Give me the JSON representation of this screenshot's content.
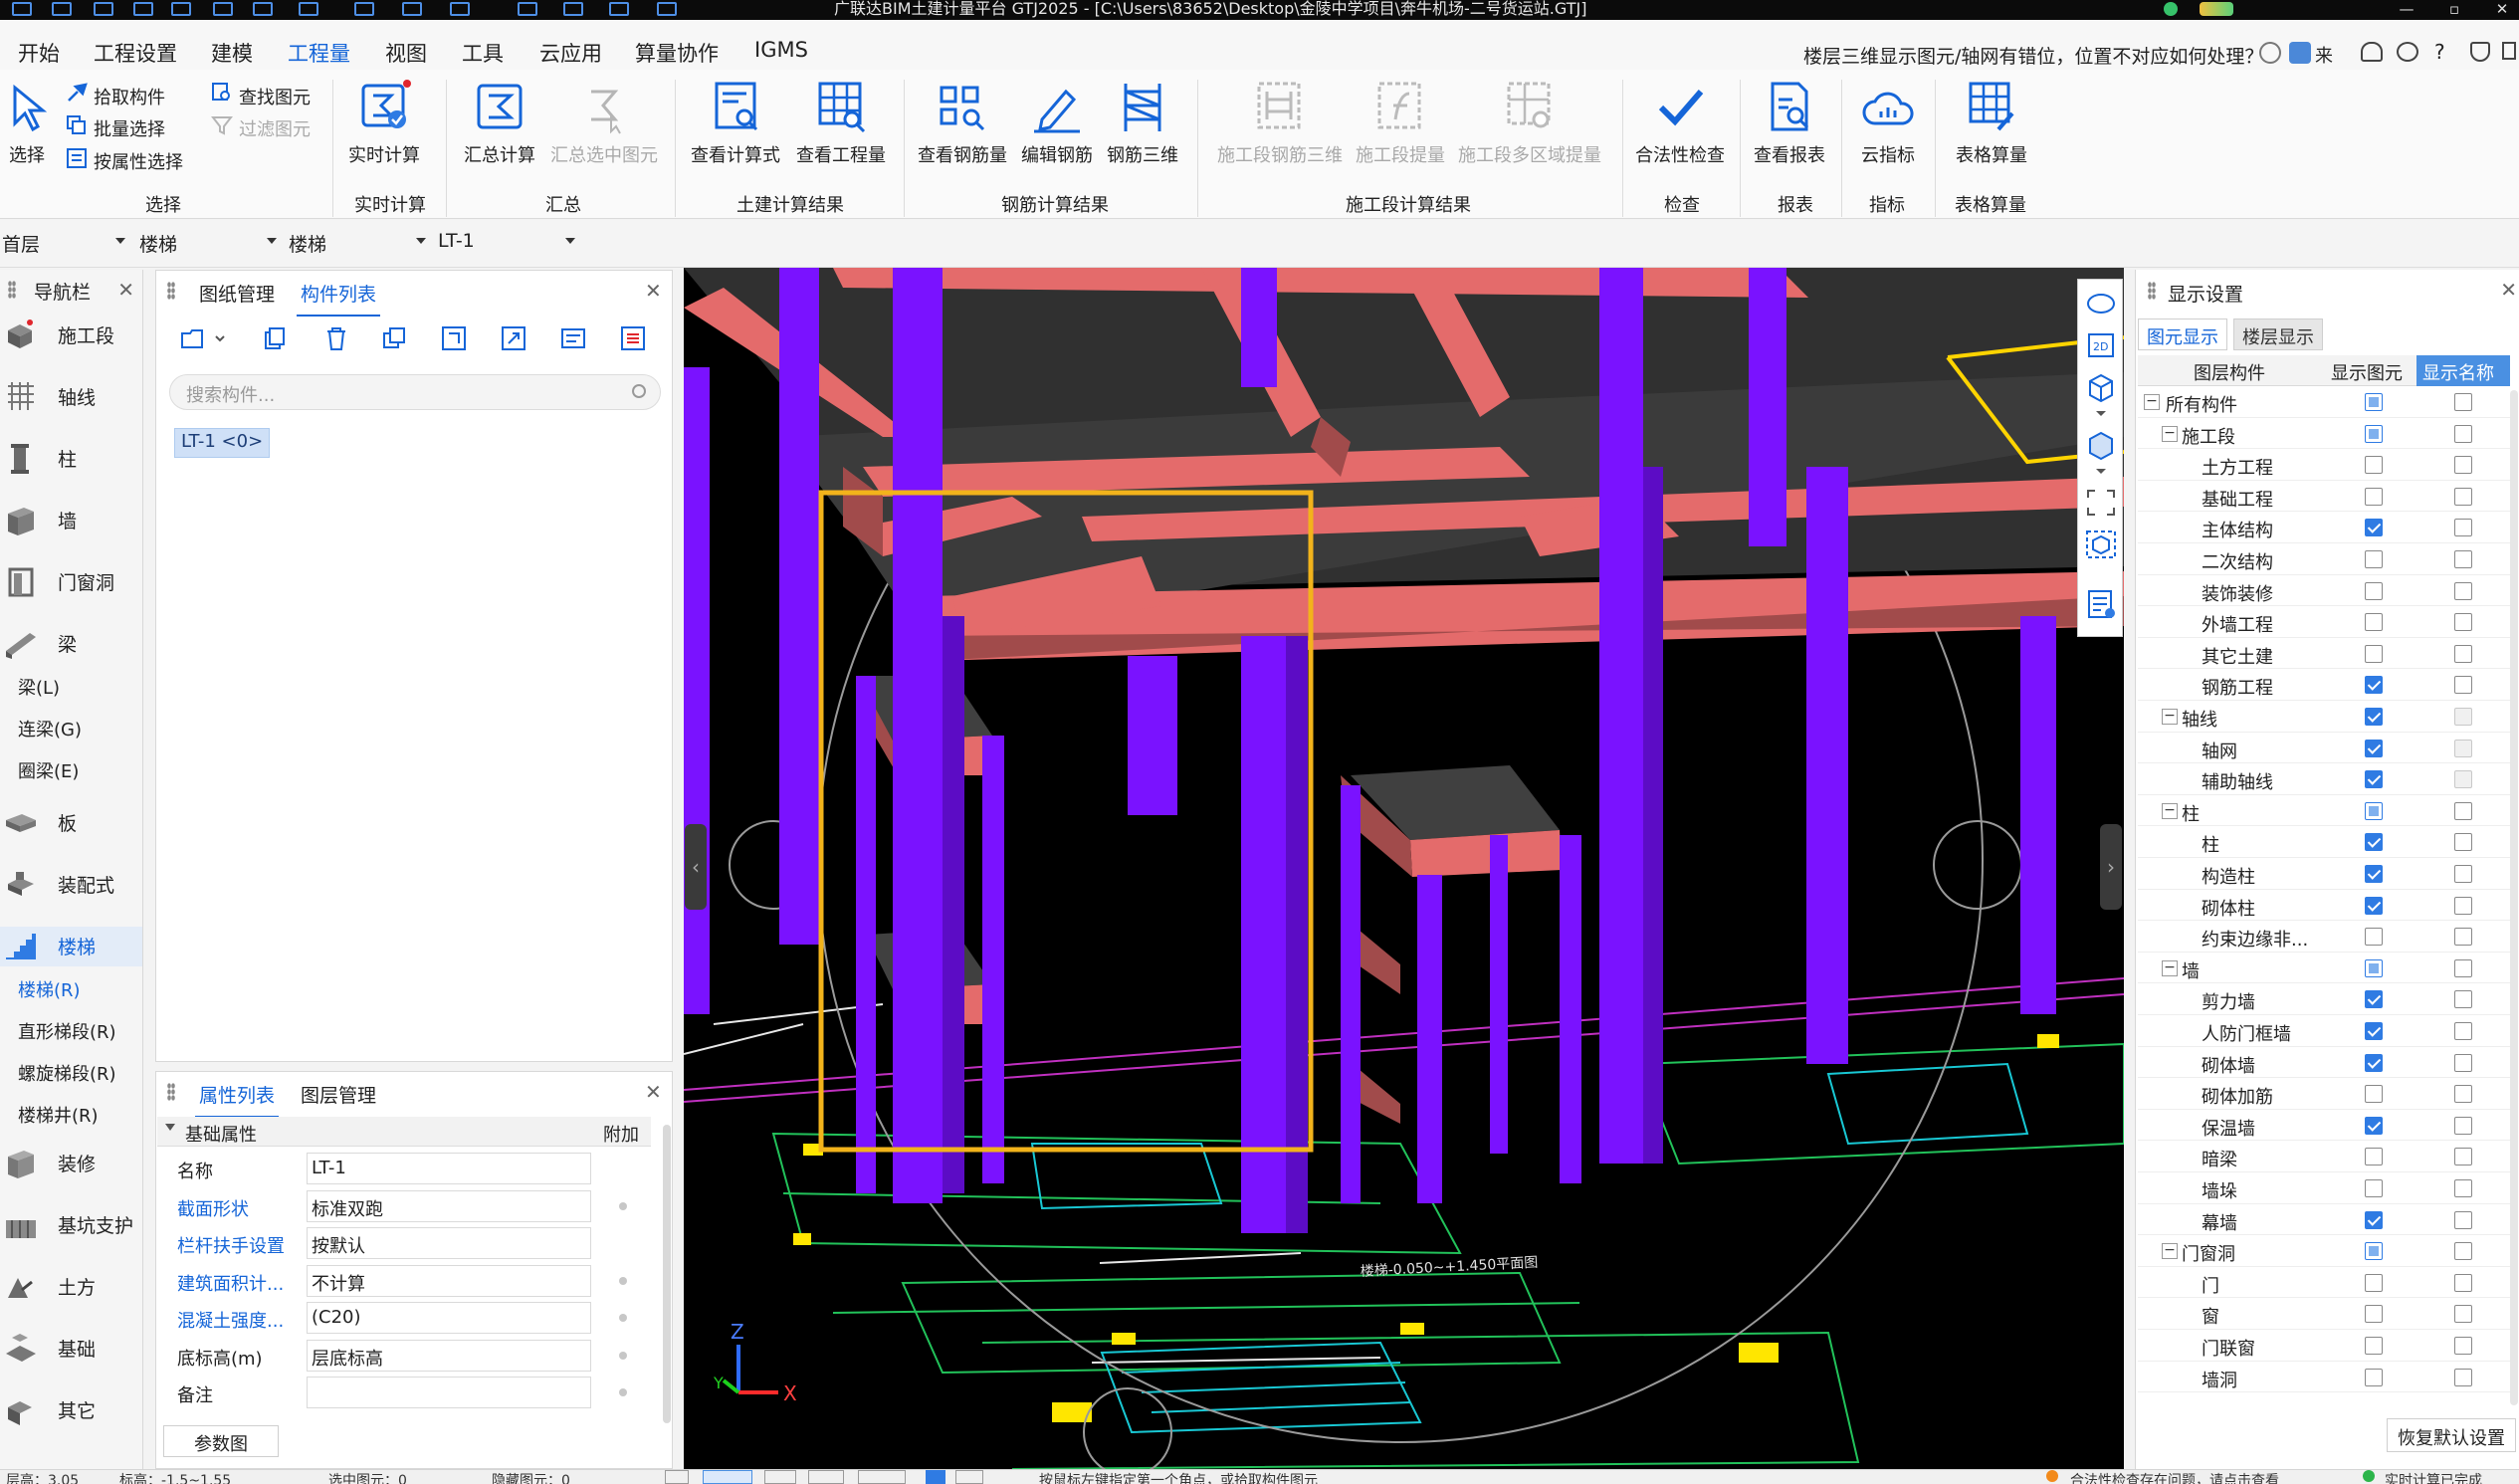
{
  "titlebar": {
    "title": "广联达BIM土建计量平台 GTJ2025 - [C:\\Users\\83652\\Desktop\\金陵中学项目\\奔牛机场-二号货运站.GTJ]",
    "min": "—",
    "max": "▫",
    "close": "✕"
  },
  "ribbon_tabs": [
    "开始",
    "工程设置",
    "建模",
    "工程量",
    "视图",
    "工具",
    "云应用",
    "算量协作",
    "IGMS"
  ],
  "help": {
    "text": "楼层三维显示图元/轴网有错位，位置不对应如何处理？",
    "lai": "来",
    "q": "?"
  },
  "ribbon": {
    "select": {
      "big": "选择",
      "pick": "拾取构件",
      "batch": "批量选择",
      "attr": "按属性选择",
      "find": "查找图元",
      "filter": "过滤图元",
      "group": "选择"
    },
    "realtime": {
      "btn": "实时计算",
      "group": "实时计算"
    },
    "summary": {
      "calc": "汇总计算",
      "calc_sel": "汇总选中图元",
      "group": "汇总"
    },
    "civil": {
      "formula": "查看计算式",
      "quantity": "查看工程量",
      "group": "土建计算结果"
    },
    "rebar": {
      "qty": "查看钢筋量",
      "edit": "编辑钢筋",
      "three_d": "钢筋三维",
      "group": "钢筋计算结果"
    },
    "stage": {
      "rebar3d": "施工段钢筋三维",
      "extract": "施工段提量",
      "multi": "施工段多区域提量",
      "group": "施工段计算结果"
    },
    "check": {
      "btn": "合法性检查",
      "group": "检查"
    },
    "report": {
      "btn": "查看报表",
      "group": "报表"
    },
    "index": {
      "btn": "云指标",
      "group": "指标"
    },
    "table": {
      "btn": "表格算量",
      "group": "表格算量"
    }
  },
  "toolbar2": {
    "floor": "首层",
    "cat1": "楼梯",
    "cat2": "楼梯",
    "item": "LT-1"
  },
  "nav": {
    "title": "导航栏",
    "items": [
      {
        "label": "施工段",
        "icon": "construction-stage-icon"
      },
      {
        "label": "轴线",
        "icon": "grid-icon"
      },
      {
        "label": "柱",
        "icon": "column-icon"
      },
      {
        "label": "墙",
        "icon": "wall-icon"
      },
      {
        "label": "门窗洞",
        "icon": "door-window-icon"
      },
      {
        "label": "梁",
        "icon": "beam-icon"
      }
    ],
    "beam_subs": [
      "梁(L)",
      "连梁(G)",
      "圈梁(E)"
    ],
    "items2": [
      {
        "label": "板",
        "icon": "slab-icon"
      },
      {
        "label": "装配式",
        "icon": "prefab-icon"
      },
      {
        "label": "楼梯",
        "icon": "stair-icon"
      }
    ],
    "stair_subs": [
      "楼梯(R)",
      "直形梯段(R)",
      "螺旋梯段(R)",
      "楼梯井(R)"
    ],
    "items3": [
      {
        "label": "装修",
        "icon": "decoration-icon"
      },
      {
        "label": "基坑支护",
        "icon": "pit-support-icon"
      },
      {
        "label": "土方",
        "icon": "earthwork-icon"
      },
      {
        "label": "基础",
        "icon": "foundation-icon"
      },
      {
        "label": "其它",
        "icon": "other-icon"
      }
    ]
  },
  "component_panel": {
    "tab1": "图纸管理",
    "tab2": "构件列表",
    "search_placeholder": "搜索构件...",
    "item": "LT-1 <0>"
  },
  "prop_panel": {
    "tab1": "属性列表",
    "tab2": "图层管理",
    "section": "基础属性",
    "extra_col": "附加",
    "rows": [
      {
        "key": "名称",
        "value": "LT-1",
        "blue": false,
        "dot": false
      },
      {
        "key": "截面形状",
        "value": "标准双跑",
        "blue": true,
        "dot": true
      },
      {
        "key": "栏杆扶手设置",
        "value": "按默认",
        "blue": true,
        "dot": false
      },
      {
        "key": "建筑面积计...",
        "value": "不计算",
        "blue": true,
        "dot": true
      },
      {
        "key": "混凝土强度...",
        "value": "(C20)",
        "blue": true,
        "dot": true
      },
      {
        "key": "底标高(m)",
        "value": "层底标高",
        "blue": false,
        "dot": true
      },
      {
        "key": "备注",
        "value": "",
        "blue": false,
        "dot": true
      }
    ],
    "param_btn": "参数图"
  },
  "viewport": {
    "axis_x": "X",
    "axis_z": "Z",
    "axis_y": "Y",
    "section_label": "楼梯-0.050~+1.450平面图"
  },
  "display": {
    "title": "显示设置",
    "tab1": "图元显示",
    "tab2": "楼层显示",
    "col_layer": "图层构件",
    "col_show": "显示图元",
    "col_name": "显示名称",
    "rows": [
      {
        "name": "所有构件",
        "level": 0,
        "exp": "−",
        "show": "part",
        "nm": "off",
        "blue": false
      },
      {
        "name": "施工段",
        "level": 1,
        "exp": "−",
        "show": "part",
        "nm": "off",
        "blue": false
      },
      {
        "name": "土方工程",
        "level": 2,
        "exp": "",
        "show": "off",
        "nm": "off",
        "blue": false
      },
      {
        "name": "基础工程",
        "level": 2,
        "exp": "",
        "show": "off",
        "nm": "off",
        "blue": false
      },
      {
        "name": "主体结构",
        "level": 2,
        "exp": "",
        "show": "on",
        "nm": "off",
        "blue": false
      },
      {
        "name": "二次结构",
        "level": 2,
        "exp": "",
        "show": "off",
        "nm": "off",
        "blue": false
      },
      {
        "name": "装饰装修",
        "level": 2,
        "exp": "",
        "show": "off",
        "nm": "off",
        "blue": false
      },
      {
        "name": "外墙工程",
        "level": 2,
        "exp": "",
        "show": "off",
        "nm": "off",
        "blue": false
      },
      {
        "name": "其它土建",
        "level": 2,
        "exp": "",
        "show": "off",
        "nm": "off",
        "blue": false
      },
      {
        "name": "钢筋工程",
        "level": 2,
        "exp": "",
        "show": "on",
        "nm": "off",
        "blue": false
      },
      {
        "name": "轴线",
        "level": 1,
        "exp": "−",
        "show": "on",
        "nm": "dis",
        "blue": false
      },
      {
        "name": "轴网",
        "level": 2,
        "exp": "",
        "show": "on",
        "nm": "dis",
        "blue": false
      },
      {
        "name": "辅助轴线",
        "level": 2,
        "exp": "",
        "show": "on",
        "nm": "dis",
        "blue": false
      },
      {
        "name": "柱",
        "level": 1,
        "exp": "−",
        "show": "part",
        "nm": "off",
        "blue": false
      },
      {
        "name": "柱",
        "level": 2,
        "exp": "",
        "show": "on",
        "nm": "off",
        "blue": false
      },
      {
        "name": "构造柱",
        "level": 2,
        "exp": "",
        "show": "on",
        "nm": "off",
        "blue": false
      },
      {
        "name": "砌体柱",
        "level": 2,
        "exp": "",
        "show": "on",
        "nm": "off",
        "blue": false
      },
      {
        "name": "约束边缘非...",
        "level": 2,
        "exp": "",
        "show": "off",
        "nm": "off",
        "blue": false
      },
      {
        "name": "墙",
        "level": 1,
        "exp": "−",
        "show": "part",
        "nm": "off",
        "blue": false
      },
      {
        "name": "剪力墙",
        "level": 2,
        "exp": "",
        "show": "on",
        "nm": "off",
        "blue": false
      },
      {
        "name": "人防门框墙",
        "level": 2,
        "exp": "",
        "show": "on",
        "nm": "off",
        "blue": false
      },
      {
        "name": "砌体墙",
        "level": 2,
        "exp": "",
        "show": "on",
        "nm": "off",
        "blue": false
      },
      {
        "name": "砌体加筋",
        "level": 2,
        "exp": "",
        "show": "off",
        "nm": "off",
        "blue": false
      },
      {
        "name": "保温墙",
        "level": 2,
        "exp": "",
        "show": "on",
        "nm": "off",
        "blue": false
      },
      {
        "name": "暗梁",
        "level": 2,
        "exp": "",
        "show": "off",
        "nm": "off",
        "blue": false
      },
      {
        "name": "墙垛",
        "level": 2,
        "exp": "",
        "show": "off",
        "nm": "off",
        "blue": false
      },
      {
        "name": "幕墙",
        "level": 2,
        "exp": "",
        "show": "on",
        "nm": "off",
        "blue": false
      },
      {
        "name": "门窗洞",
        "level": 1,
        "exp": "−",
        "show": "part",
        "nm": "off",
        "blue": false
      },
      {
        "name": "门",
        "level": 2,
        "exp": "",
        "show": "off",
        "nm": "off",
        "blue": false
      },
      {
        "name": "窗",
        "level": 2,
        "exp": "",
        "show": "off",
        "nm": "off",
        "blue": false
      },
      {
        "name": "门联窗",
        "level": 2,
        "exp": "",
        "show": "off",
        "nm": "off",
        "blue": false
      },
      {
        "name": "墙洞",
        "level": 2,
        "exp": "",
        "show": "off",
        "nm": "off",
        "blue": false
      }
    ],
    "restore": "恢复默认设置"
  },
  "status": {
    "floor_h": "层高：3.05",
    "elev": "标高：-1.5~1.55",
    "selected": "选中图元：0",
    "hidden": "隐藏图元：0",
    "hint": "按鼠标左键指定第一个角点，或拾取构件图元",
    "check": "合法性检查存在问题，请点击查看",
    "saved": "实时计算已完成"
  },
  "colors": {
    "accent": "#1565d8",
    "beam": "#e46b6b",
    "column": "#7a12ff",
    "highlight": "#f2b31b"
  }
}
